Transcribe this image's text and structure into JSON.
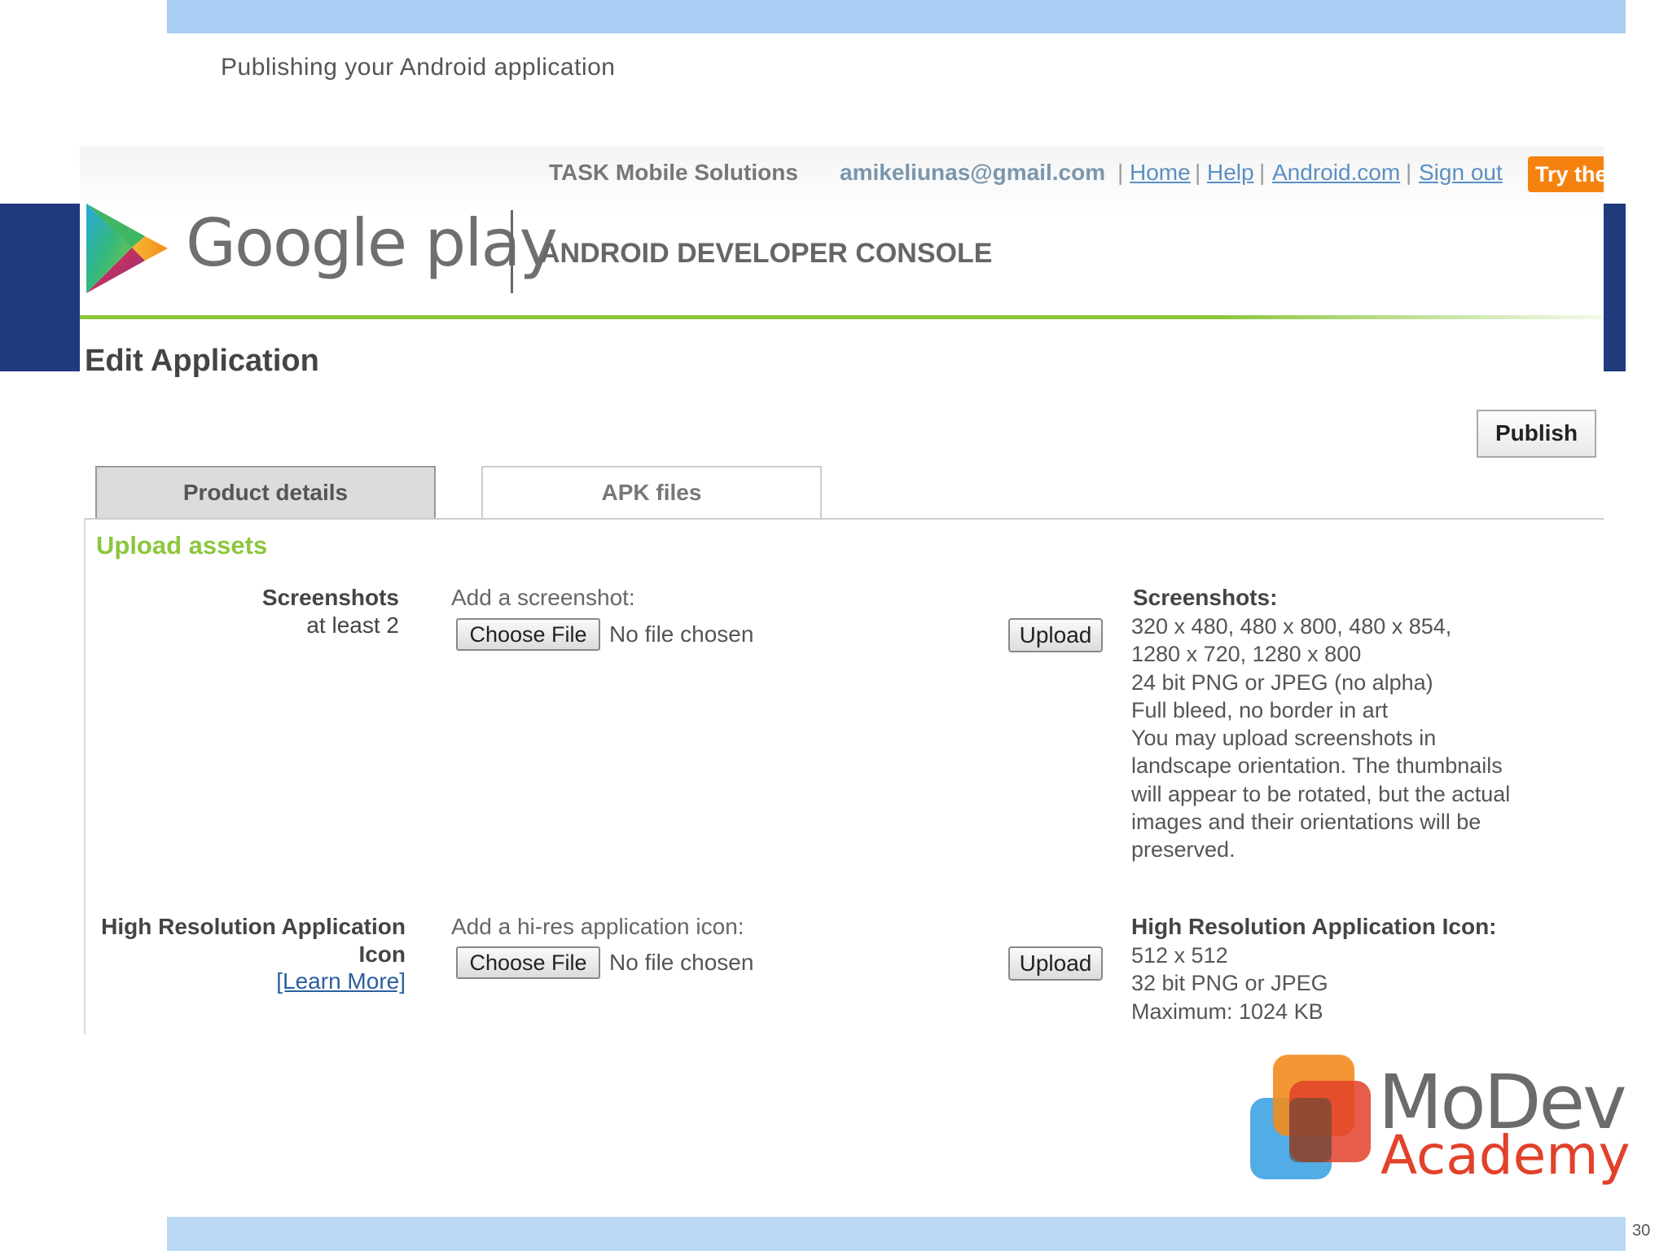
{
  "slide": {
    "title": "Publishing your Android application",
    "page_number": "30"
  },
  "console_header": {
    "company": "TASK Mobile Solutions",
    "email": "amikeliunas@gmail.com",
    "links": [
      "Home",
      "Help",
      "Android.com",
      "Sign out"
    ],
    "separator": "|",
    "try_button": "Try the",
    "brand_text": "Google play",
    "console_title": "ANDROID DEVELOPER CONSOLE"
  },
  "page": {
    "title": "Edit Application",
    "publish_label": "Publish",
    "tabs": [
      {
        "label": "Product details",
        "active": true
      },
      {
        "label": "APK files",
        "active": false
      }
    ],
    "section_title": "Upload assets"
  },
  "screenshots": {
    "label": "Screenshots",
    "sublabel": "at least 2",
    "caption": "Add a screenshot:",
    "choose_label": "Choose File",
    "file_status": "No file chosen",
    "upload_label": "Upload",
    "info_title": "Screenshots:",
    "info_lines": [
      "320 x 480, 480 x 800, 480 x 854,",
      "1280 x 720, 1280 x 800",
      "24 bit PNG or JPEG (no alpha)",
      "Full bleed, no border in art",
      "You may upload screenshots in",
      "landscape orientation. The thumbnails",
      "will appear to be rotated, but the actual",
      "images and their orientations will be",
      "preserved."
    ]
  },
  "hires_icon": {
    "label_line1": "High Resolution Application",
    "label_line2": "Icon",
    "learn_more": "[Learn More]",
    "caption": "Add a hi-res application icon:",
    "choose_label": "Choose File",
    "file_status": "No file chosen",
    "upload_label": "Upload",
    "info_title": "High Resolution Application Icon:",
    "info_lines": [
      "512 x 512",
      "32 bit PNG or JPEG",
      "Maximum: 1024 KB"
    ]
  },
  "branding": {
    "line1": "MoDev",
    "line2": "Academy"
  },
  "colors": {
    "top_band": "#aacdf3",
    "navy": "#203a7e",
    "play_green": "#8dc63f",
    "try_orange": "#f5820f",
    "link_blue": "#5b8fc2",
    "modev_red": "#e2412a"
  }
}
